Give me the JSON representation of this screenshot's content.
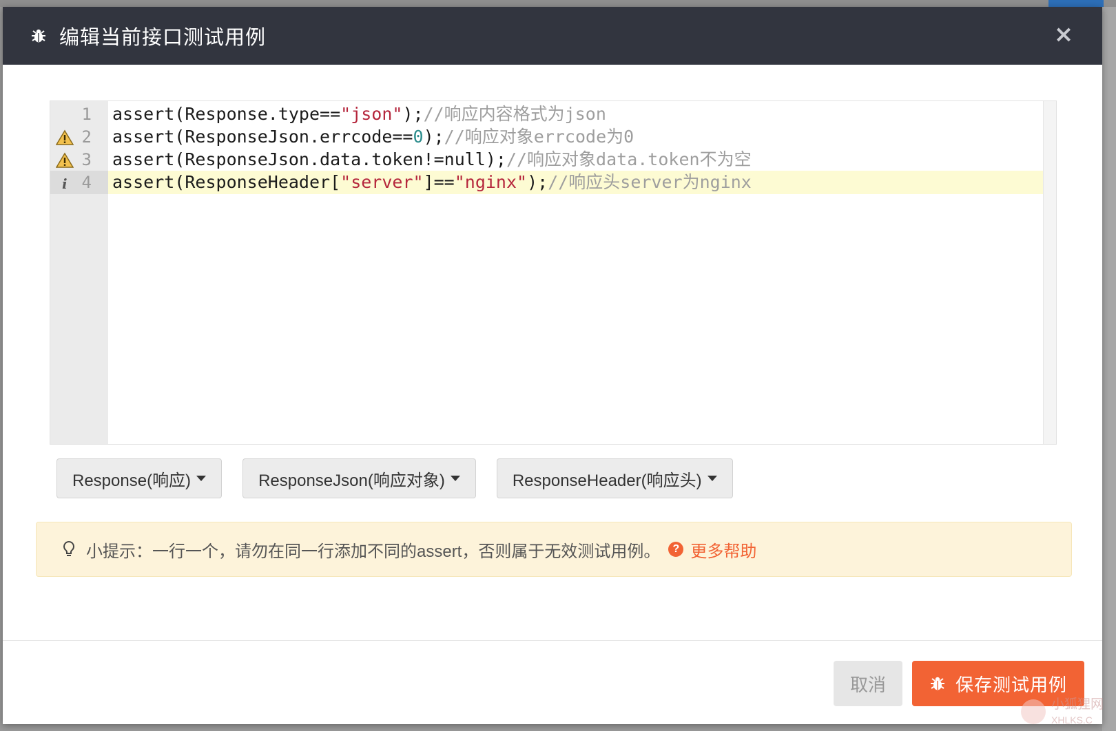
{
  "dialog": {
    "title": "编辑当前接口测试用例",
    "close_symbol": "×",
    "icon": "bug-icon"
  },
  "editor": {
    "lines": [
      {
        "number": "1",
        "marker": null,
        "active": false,
        "tokens": [
          {
            "t": "assert(Response.type==",
            "c": "plain"
          },
          {
            "t": "\"json\"",
            "c": "str"
          },
          {
            "t": ");",
            "c": "plain"
          },
          {
            "t": "//响应内容格式为json",
            "c": "com"
          }
        ]
      },
      {
        "number": "2",
        "marker": "warning-icon",
        "active": false,
        "tokens": [
          {
            "t": "assert(ResponseJson.errcode==",
            "c": "plain"
          },
          {
            "t": "0",
            "c": "num"
          },
          {
            "t": ");",
            "c": "plain"
          },
          {
            "t": "//响应对象errcode为0",
            "c": "com"
          }
        ]
      },
      {
        "number": "3",
        "marker": "warning-icon",
        "active": false,
        "tokens": [
          {
            "t": "assert(ResponseJson.data.token!=null);",
            "c": "plain"
          },
          {
            "t": "//响应对象data.token不为空",
            "c": "com"
          }
        ]
      },
      {
        "number": "4",
        "marker": "info-icon",
        "active": true,
        "tokens": [
          {
            "t": "assert(ResponseHeader[",
            "c": "plain"
          },
          {
            "t": "\"server\"",
            "c": "str"
          },
          {
            "t": "]==",
            "c": "plain"
          },
          {
            "t": "\"nginx\"",
            "c": "str"
          },
          {
            "t": ");",
            "c": "plain"
          },
          {
            "t": "//响应头server为nginx",
            "c": "com"
          }
        ]
      }
    ]
  },
  "dropdowns": {
    "response": "Response(响应)",
    "response_json": "ResponseJson(响应对象)",
    "response_header": "ResponseHeader(响应头)"
  },
  "tip": {
    "text": "小提示：一行一个，请勿在同一行添加不同的assert，否则属于无效测试用例。",
    "help_icon_glyph": "?",
    "help_link": "更多帮助"
  },
  "footer": {
    "cancel_label": "取消",
    "save_label": "保存测试用例"
  },
  "watermark": {
    "line1": "小狐狸网",
    "line2": "XHLKS.C"
  },
  "colors": {
    "accent": "#f26334",
    "header_bg": "#32353f",
    "tip_bg": "#fdf3da",
    "string": "#b5263c",
    "number": "#2a8c8c",
    "comment": "#9e9e9e"
  }
}
